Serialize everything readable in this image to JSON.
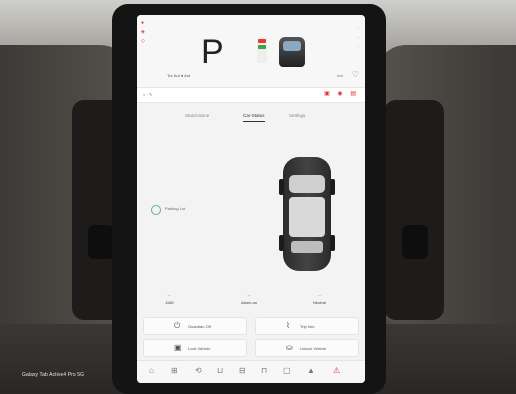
{
  "caption": "Galaxy Tab Active4 Pro 5G",
  "top": {
    "gear": "P",
    "left_icons": [
      "#d33",
      "#777",
      "#777"
    ],
    "status_left": "Tur Aut ● Aut",
    "status_right": "Aut",
    "right_lines": [
      "–",
      "–",
      "–"
    ]
  },
  "addr": {
    "left": "< ·  ✎",
    "right_icons": "▣ ◉ ▤"
  },
  "tabs": {
    "items": [
      "Stand-alone",
      "Car-Status",
      "Settings"
    ],
    "active_index": 1
  },
  "location": {
    "label": "Parking Lot"
  },
  "stats": [
    {
      "label": "—",
      "value": "1185"
    },
    {
      "label": "—",
      "value": "Alarm-on"
    },
    {
      "label": "—",
      "value": "Neutral"
    }
  ],
  "buttons": [
    {
      "label": "Guardian Off",
      "icon": "power-icon"
    },
    {
      "label": "Trip Info",
      "icon": "route-icon"
    },
    {
      "label": "Lock Vehicle",
      "icon": "lock-icon"
    },
    {
      "label": "Unlock Vehicle",
      "icon": "car-icon"
    }
  ],
  "dock": [
    "⌂",
    "⊞",
    "⟲",
    "⊔",
    "⊟",
    "⊓",
    "▢",
    "▲",
    "⚠"
  ]
}
